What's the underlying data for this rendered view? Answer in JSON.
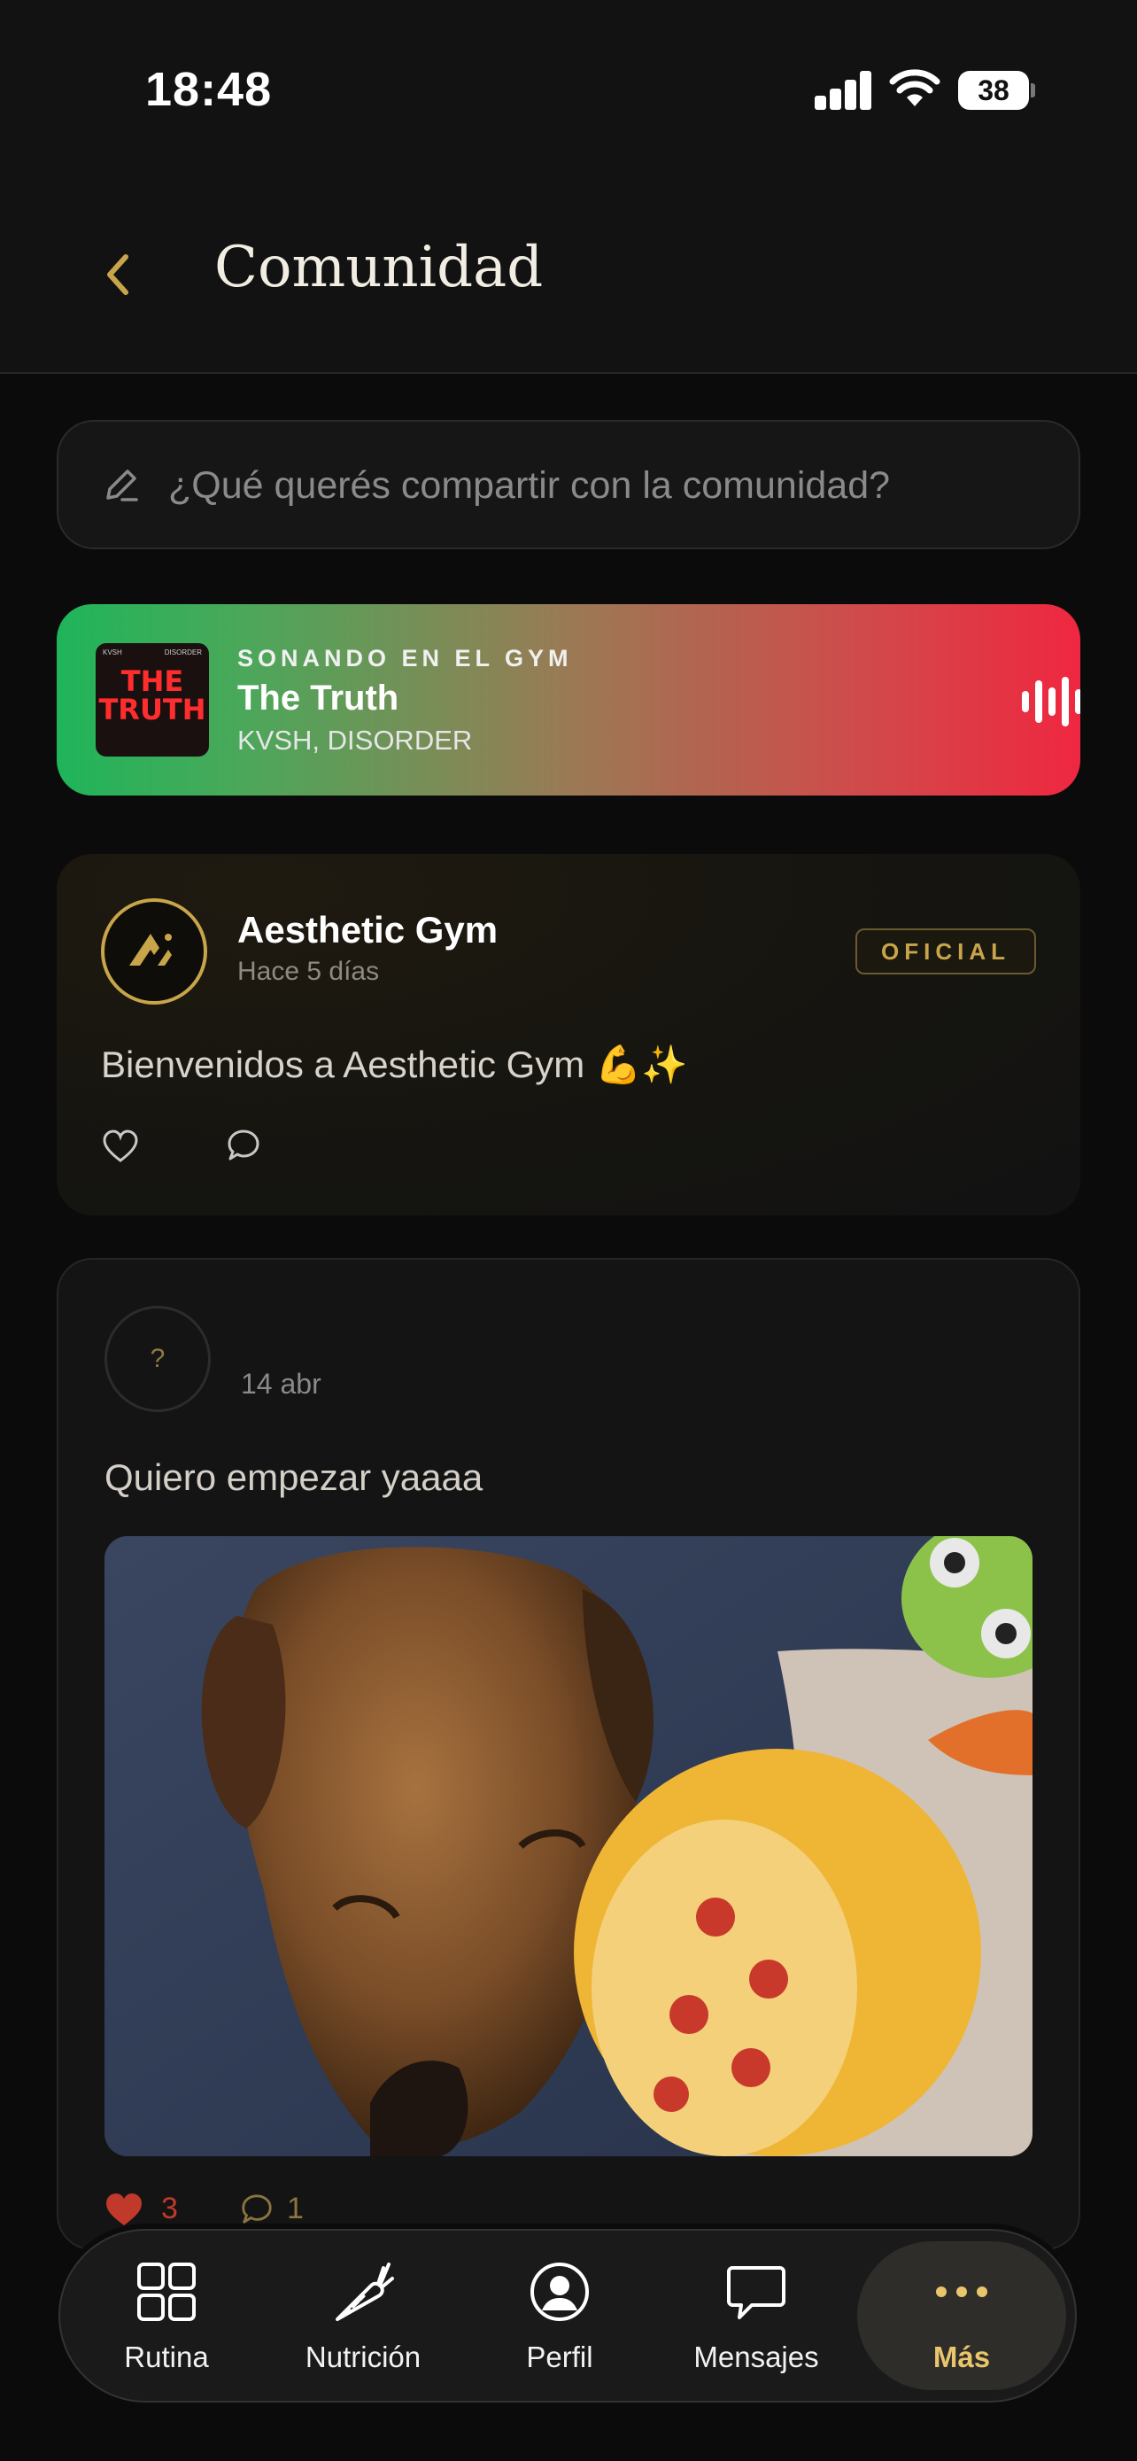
{
  "status_bar": {
    "time": "18:48",
    "battery": "38"
  },
  "header": {
    "title": "Comunidad",
    "back_icon": "chevron-left-icon"
  },
  "composer": {
    "placeholder": "¿Qué querés compartir con la comunidad?"
  },
  "now_playing": {
    "label": "SONANDO EN EL GYM",
    "song": "The Truth",
    "artist": "KVSH, DISORDER",
    "cover_text_1": "THE",
    "cover_text_2": "TRUTH",
    "cover_small_left": "KVSH",
    "cover_small_right": "DISORDER",
    "gradient_start": "#1fb55a",
    "gradient_end": "#ef2740"
  },
  "posts": [
    {
      "author": "Aesthetic Gym",
      "time": "Hace 5 días",
      "badge": "OFICIAL",
      "text": "Bienvenidos a Aesthetic Gym 💪✨"
    },
    {
      "avatar_placeholder": "?",
      "date": "14 abr",
      "text": "Quiero empezar yaaaa",
      "likes": "3",
      "comments": "1"
    }
  ],
  "tabs": [
    {
      "label": "Rutina",
      "icon": "grid-icon"
    },
    {
      "label": "Nutrición",
      "icon": "carrot-icon"
    },
    {
      "label": "Perfil",
      "icon": "user-circle-icon"
    },
    {
      "label": "Mensajes",
      "icon": "chat-bubble-icon"
    },
    {
      "label": "Más",
      "icon": "more-dots-icon",
      "active": true
    }
  ],
  "colors": {
    "accent": "#e9c56b",
    "gold": "#c9a54a",
    "background": "#0b0b0b"
  }
}
